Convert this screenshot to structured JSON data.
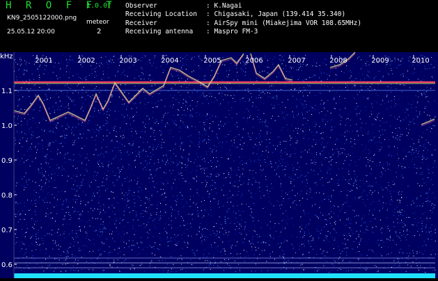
{
  "header": {
    "app_title": "H R O F F T",
    "version": "1.0.0f",
    "filename": "KN9_2505122000.png",
    "meteor_label": "meteor",
    "meteor_count": "2",
    "timestamp": "25.05.12 20:00",
    "info": [
      {
        "key": "Observer",
        "value": ": K.Nagai"
      },
      {
        "key": "Receiving Location",
        "value": ": Chigasaki, Japan (139.414 35.340)"
      },
      {
        "key": "Receiver",
        "value": ": AirSpy mini (Miakejima VOR 108.65MHz)"
      },
      {
        "key": "Receiving antenna",
        "value": ": Maspro FM-3"
      }
    ]
  },
  "spectrogram": {
    "y_unit": "kHz",
    "y_ticks": [
      "1.1",
      "1.0",
      "0.9",
      "0.8",
      "0.7",
      "0.6"
    ],
    "x_ticks": [
      "2001",
      "2002",
      "2003",
      "2004",
      "2005",
      "2006",
      "2007",
      "2008",
      "2009",
      "2010"
    ],
    "colors": {
      "background": "#000060",
      "carrier": "#ff4060",
      "trace": "#e0e090",
      "baseline": "#20e0ff"
    }
  }
}
